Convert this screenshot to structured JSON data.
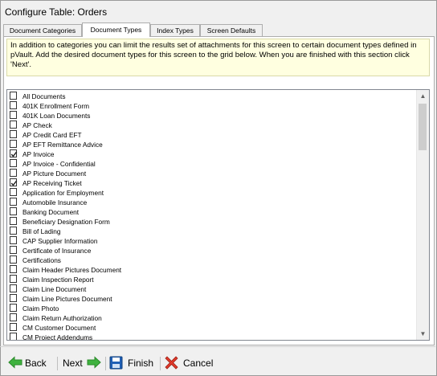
{
  "window": {
    "title": "Configure Table: Orders"
  },
  "tabs": [
    {
      "label": "Document Categories",
      "active": false
    },
    {
      "label": "Document Types",
      "active": true
    },
    {
      "label": "Index Types",
      "active": false
    },
    {
      "label": "Screen Defaults",
      "active": false
    }
  ],
  "instructions": "In addition to categories you can limit the results set of attachments for this screen to certain document types defined in pVault.  Add the desired document types for this screen to the grid below. When you are finished with this section click 'Next'.",
  "document_types": [
    {
      "label": "All Documents",
      "checked": false
    },
    {
      "label": "401K Enrollment Form",
      "checked": false
    },
    {
      "label": "401K Loan Documents",
      "checked": false
    },
    {
      "label": "AP Check",
      "checked": false
    },
    {
      "label": "AP Credit Card EFT",
      "checked": false
    },
    {
      "label": "AP EFT Remittance Advice",
      "checked": false
    },
    {
      "label": "AP Invoice",
      "checked": true
    },
    {
      "label": "AP Invoice - Confidential",
      "checked": false
    },
    {
      "label": "AP Picture Document",
      "checked": false
    },
    {
      "label": "AP Receiving Ticket",
      "checked": true
    },
    {
      "label": "Application for Employment",
      "checked": false
    },
    {
      "label": "Automobile Insurance",
      "checked": false
    },
    {
      "label": "Banking Document",
      "checked": false
    },
    {
      "label": "Beneficiary Designation Form",
      "checked": false
    },
    {
      "label": "Bill of Lading",
      "checked": false
    },
    {
      "label": "CAP Supplier Information",
      "checked": false
    },
    {
      "label": "Certificate of Insurance",
      "checked": false
    },
    {
      "label": "Certifications",
      "checked": false
    },
    {
      "label": "Claim Header Pictures Document",
      "checked": false
    },
    {
      "label": "Claim Inspection Report",
      "checked": false
    },
    {
      "label": "Claim Line Document",
      "checked": false
    },
    {
      "label": "Claim Line Pictures Document",
      "checked": false
    },
    {
      "label": "Claim Photo",
      "checked": false
    },
    {
      "label": "Claim Return Authorization",
      "checked": false
    },
    {
      "label": "CM Customer Document",
      "checked": false
    },
    {
      "label": "CM Project Addendums",
      "checked": false
    }
  ],
  "footer": {
    "back_label": "Back",
    "next_label": "Next",
    "finish_label": "Finish",
    "cancel_label": "Cancel"
  },
  "colors": {
    "instructions_bg": "#ffffe0",
    "arrow_green": "#3fb23f",
    "cancel_red": "#e03a2b",
    "save_blue": "#1f5fb5"
  }
}
